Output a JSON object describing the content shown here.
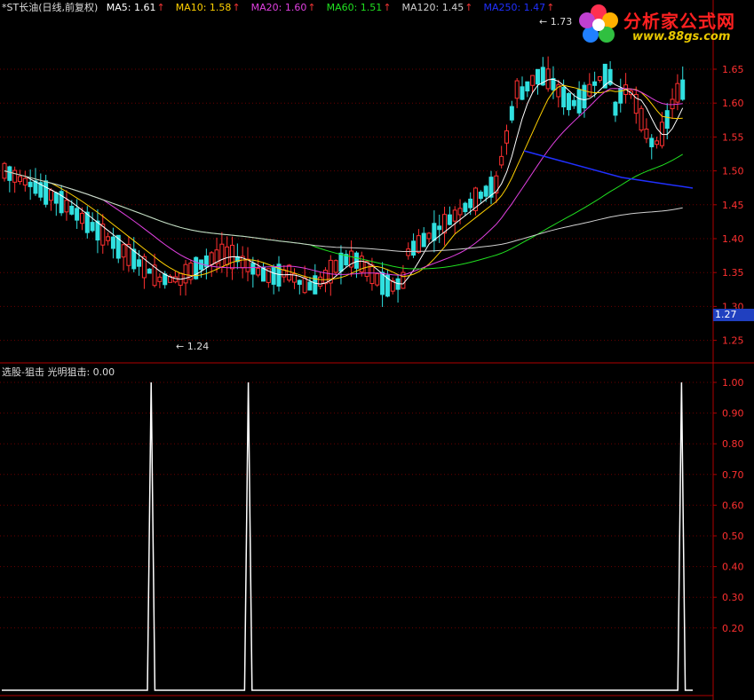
{
  "header": {
    "title": "*ST长油(日线,前复权)",
    "indicators": [
      {
        "label": "MA5: 1.61",
        "color": "#ffffff"
      },
      {
        "label": "MA10: 1.58",
        "color": "#ffd000"
      },
      {
        "label": "MA20: 1.60",
        "color": "#e040e0"
      },
      {
        "label": "MA60: 1.51",
        "color": "#20e020"
      },
      {
        "label": "MA120: 1.45",
        "color": "#d0d0d0"
      },
      {
        "label": "MA250: 1.47",
        "color": "#2030ff"
      }
    ],
    "arrow_glyph": "↑"
  },
  "lower_header": {
    "label": "选股-狙击  光明狙击: 0.00"
  },
  "logo": {
    "title": "分析家公式网",
    "url": "www.88gs.com"
  },
  "price_axis": {
    "ticks": [
      "1.65",
      "1.60",
      "1.55",
      "1.50",
      "1.45",
      "1.40",
      "1.35",
      "1.30",
      "1.25"
    ],
    "current_price": "1.27"
  },
  "indicator_axis": {
    "ticks": [
      "1.00",
      "0.90",
      "0.80",
      "0.70",
      "0.60",
      "0.50",
      "0.40",
      "0.30",
      "0.20"
    ]
  },
  "annotations": {
    "high": "1.73",
    "low": "1.24"
  },
  "colors": {
    "up": "#ff3030",
    "down": "#30e0e0",
    "grid": "#6a0000",
    "axis": "#b00000"
  },
  "signal_values": [
    0,
    0,
    0,
    0,
    0,
    0,
    0,
    0,
    0,
    0,
    0,
    0,
    0,
    0,
    0,
    0,
    0,
    0,
    0,
    0,
    0,
    0,
    0,
    0,
    0,
    0,
    0,
    0,
    0,
    0,
    0,
    0,
    0,
    0,
    0,
    0,
    0,
    0,
    0,
    0,
    1,
    0,
    0,
    0,
    0,
    0,
    0,
    0,
    0,
    0,
    0,
    0,
    0,
    0,
    0,
    0,
    0,
    0,
    0,
    0,
    0,
    0,
    0,
    0,
    0,
    0,
    1,
    0,
    0,
    0,
    0,
    0,
    0,
    0,
    0,
    0,
    0,
    0,
    0,
    0,
    0,
    0,
    0,
    0,
    0,
    0,
    0,
    0,
    0,
    0,
    0,
    0,
    0,
    0,
    0,
    0,
    0,
    0,
    0,
    0,
    0,
    0,
    0,
    0,
    0,
    0,
    0,
    0,
    0,
    0,
    0,
    0,
    0,
    0,
    0,
    0,
    0,
    0,
    0,
    0,
    0,
    0,
    0,
    0,
    0,
    0,
    0,
    0,
    0,
    0,
    0,
    0,
    0,
    0,
    0,
    0,
    0,
    0,
    0,
    0,
    0,
    0,
    0,
    0,
    0,
    0,
    0,
    0,
    0,
    0,
    0,
    0,
    0,
    0,
    0,
    0,
    0,
    0,
    0,
    0,
    0,
    0,
    0,
    0,
    0,
    0,
    0,
    0,
    0,
    0,
    0,
    0,
    0,
    0,
    0,
    0,
    0,
    0,
    0,
    0,
    0,
    0,
    1,
    0,
    0,
    0
  ]
}
